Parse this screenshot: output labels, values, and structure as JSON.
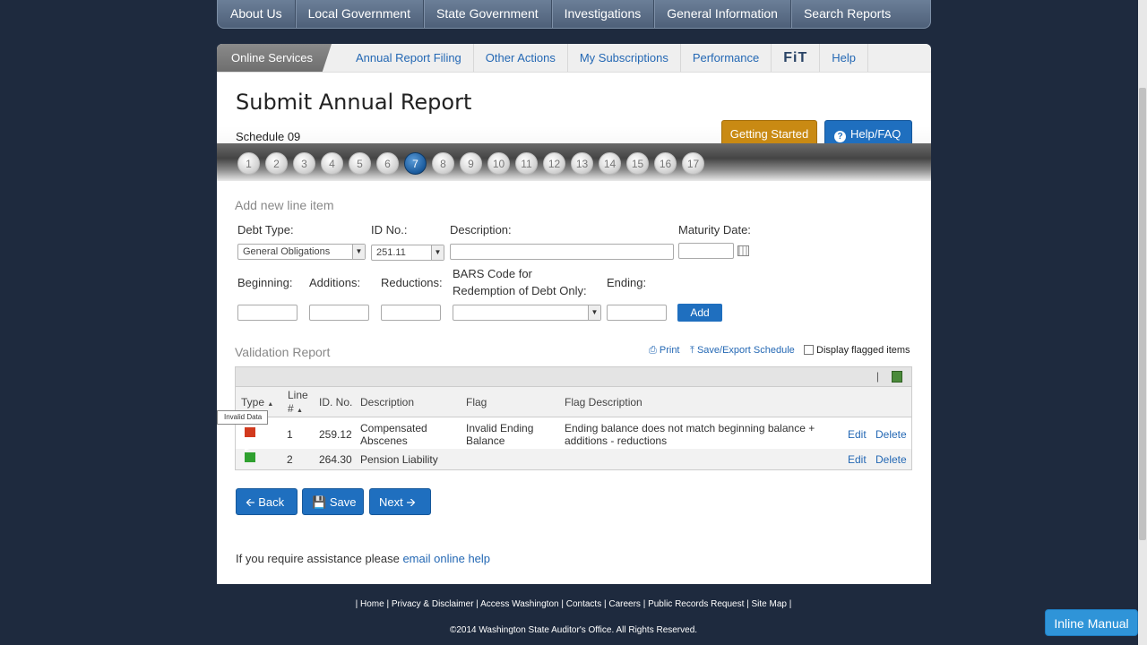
{
  "topnav": [
    "About Us",
    "Local Government",
    "State Government",
    "Investigations",
    "General Information",
    "Search Reports"
  ],
  "subnav": {
    "active": "Online Services",
    "items": [
      "Annual Report Filing",
      "Other Actions",
      "My Subscriptions",
      "Performance"
    ],
    "fit": "FiT",
    "help": "Help"
  },
  "page": {
    "title": "Submit Annual Report",
    "schedule": "Schedule 09",
    "getting_started": "Getting Started",
    "help_faq": "Help/FAQ",
    "help_icon": "?"
  },
  "steps": [
    "1",
    "2",
    "3",
    "4",
    "5",
    "6",
    "7",
    "8",
    "9",
    "10",
    "11",
    "12",
    "13",
    "14",
    "15",
    "16",
    "17"
  ],
  "current_step": "7",
  "form": {
    "section": "Add new line item",
    "debt_type_label": "Debt Type:",
    "debt_type_value": "General Obligations",
    "id_label": "ID No.:",
    "id_value": "251.11",
    "description_label": "Description:",
    "maturity_label": "Maturity Date:",
    "beginning_label": "Beginning:",
    "additions_label": "Additions:",
    "reductions_label": "Reductions:",
    "bars_label_1": "BARS Code for",
    "bars_label_2": "Redemption of Debt Only:",
    "ending_label": "Ending:",
    "add_button": "Add"
  },
  "validation": {
    "section": "Validation Report",
    "print": "Print",
    "save_export": "Save/Export Schedule",
    "display_flagged": "Display flagged items",
    "columns": {
      "type": "Type",
      "line_1": "Line",
      "line_2": "#",
      "id": "ID. No.",
      "description": "Description",
      "flag": "Flag",
      "flag_description": "Flag Description"
    },
    "rows": [
      {
        "line": "1",
        "id": "259.12",
        "description_1": "Compensated",
        "description_2": "Abscenes",
        "flag_1": "Invalid Ending",
        "flag_2": "Balance",
        "flag_desc_1": "Ending balance does not match beginning balance +",
        "flag_desc_2": "additions - reductions",
        "edit": "Edit",
        "delete": "Delete",
        "flag_color": "#d23a1e"
      },
      {
        "line": "2",
        "id": "264.30",
        "description_1": "Pension Liability",
        "edit": "Edit",
        "delete": "Delete",
        "flag_color": "#2fa02f"
      }
    ],
    "tooltip": "Invalid Data"
  },
  "nav_buttons": {
    "back": "Back",
    "save": "Save",
    "next": "Next"
  },
  "assist": {
    "text": "If you require assistance please",
    "link": "email online help"
  },
  "footer": {
    "links": "| Home | Privacy & Disclaimer | Access Washington | Contacts | Careers | Public Records Request | Site Map |",
    "copyright": "©2014 Washington State Auditor's Office. All Rights Reserved."
  },
  "inline_manual": "Inline Manual"
}
